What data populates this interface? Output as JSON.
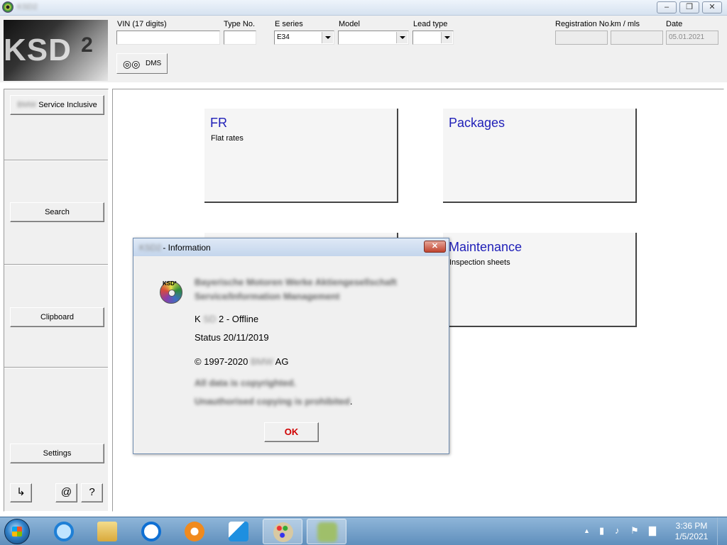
{
  "window": {
    "title": "KSD2",
    "minimize_glyph": "–",
    "restore_glyph": "❐",
    "close_glyph": "✕"
  },
  "logo": {
    "text": "KSD",
    "sup": "2"
  },
  "header": {
    "vin": {
      "label": "VIN (17 digits)",
      "value": ""
    },
    "type_no": {
      "label": "Type No.",
      "value": ""
    },
    "e_series": {
      "label": "E series",
      "value": "E34"
    },
    "model": {
      "label": "Model",
      "value": ""
    },
    "lead_type": {
      "label": "Lead type",
      "value": ""
    },
    "registration": {
      "label": "Registration No.",
      "value": ""
    },
    "km_mls": {
      "label": "km / mls",
      "value": ""
    },
    "date": {
      "label": "Date",
      "value": "05.01.2021"
    },
    "dms_label": "DMS",
    "binoculars_glyph": "◎◎"
  },
  "sidebar": {
    "service_inclusive": {
      "blurred": "BMW",
      "label": "Service Inclusive"
    },
    "search": "Search",
    "clipboard": "Clipboard",
    "settings": "Settings",
    "exit_glyph": "↳",
    "email_glyph": "@",
    "help_glyph": "?"
  },
  "tiles": [
    {
      "title": "FR",
      "subtitle": "Flat rates"
    },
    {
      "title": "Packages",
      "subtitle": ""
    },
    {
      "title": "Maintenance",
      "subtitle": "Inspection sheets"
    }
  ],
  "dialog": {
    "title_blurred": "KSD2",
    "title": "- Information",
    "close_glyph": "✕",
    "cd_label": "KSD²",
    "company_line1": "Bayerische Motoren Werke Aktiengesellschaft",
    "company_line2": "Service/Information Management",
    "product_prefix": "K",
    "product_blurred": "SD",
    "product_suffix": "2 - Offline",
    "status": "Status 20/11/2019",
    "copyright_prefix": "© 1997-2020",
    "copyright_blurred": "BMW",
    "copyright_suffix": "AG",
    "rights_line1": "All data is copyrighted.",
    "rights_line2": "Unauthorised copying is prohibited",
    "rights_line2_end": ".",
    "ok_label": "OK"
  },
  "taskbar": {
    "items": [
      {
        "name": "internet-explorer",
        "color": "#1e7fd6"
      },
      {
        "name": "file-explorer",
        "color": "#e8c25a"
      },
      {
        "name": "teamviewer",
        "color": "#0e6fd3"
      },
      {
        "name": "media-player",
        "color": "#f08a1e"
      },
      {
        "name": "remote-app",
        "color": "#1e8fe0"
      },
      {
        "name": "paint",
        "color": "#d8c9a2"
      },
      {
        "name": "ksd-app",
        "color": "#9fbf6a"
      }
    ],
    "tray": {
      "show_hidden_glyph": "▲",
      "battery_glyph": "▮",
      "volume_glyph": "♪",
      "flag_glyph": "⚑",
      "network_glyph": "▇"
    },
    "time": "3:36 PM",
    "date": "1/5/2021"
  }
}
